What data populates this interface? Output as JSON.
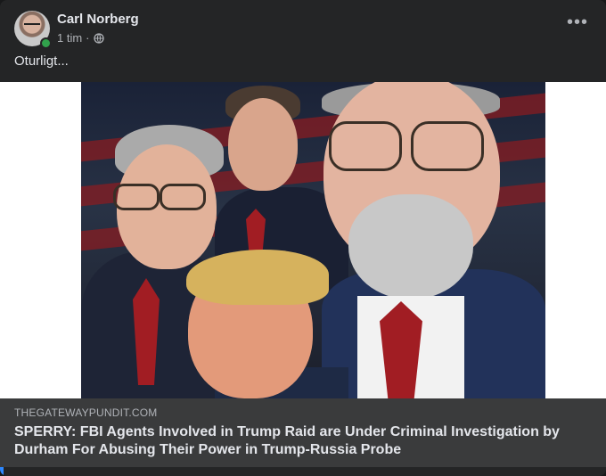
{
  "post": {
    "author": "Carl Norberg",
    "time": "1 tim",
    "separator": "·",
    "privacy_icon": "globe-icon",
    "more_label": "•••",
    "text": "Oturligt..."
  },
  "link_preview": {
    "domain": "THEGATEWAYPUNDIT.COM",
    "title": "SPERRY: FBI Agents Involved in Trump Raid are Under Criminal Investigation by Durham For Abusing Their Power in Trump-Russia Probe"
  },
  "colors": {
    "card_bg": "#242526",
    "text_primary": "#e4e6eb",
    "text_secondary": "#b0b3b8",
    "preview_bg": "#3a3b3c",
    "online": "#31a24c"
  }
}
